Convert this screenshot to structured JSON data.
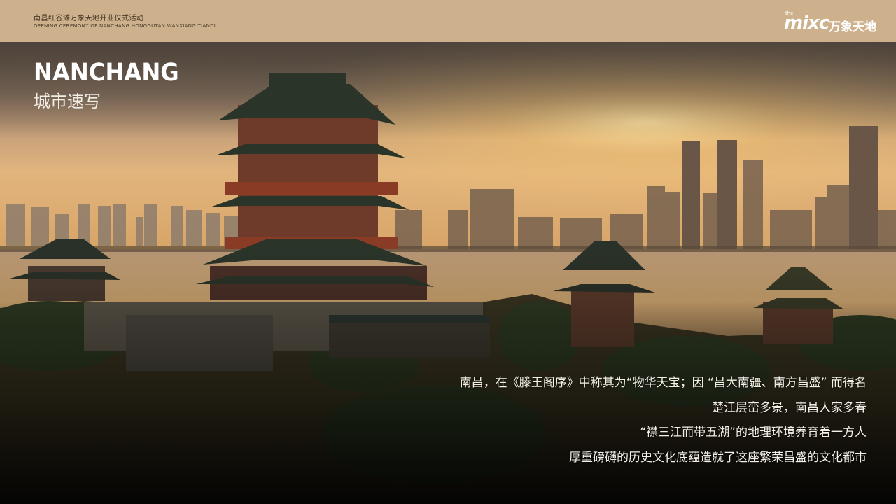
{
  "header": {
    "title_cn": "南昌红谷滩万象天地开业仪式活动",
    "title_en": "OPENING CEREMONY OF NANCHANG HONGGUTAN WANXIANG TIANDI",
    "logo": {
      "the": "the",
      "mixc": "mixc",
      "cn": "万象天地"
    }
  },
  "hero": {
    "title_en": "NANCHANG",
    "title_cn": "城市速写",
    "lines": [
      "南昌，在《滕王阁序》中称其为“物华天宝；因 “昌大南疆、南方昌盛” 而得名",
      "楚江层峦多景，南昌人家多春",
      "“襟三江而带五湖”的地理环境养育着一方人",
      "厚重磅礴的历史文化底蕴造就了这座繁荣昌盛的文化都市"
    ]
  },
  "colors": {
    "header_bg": "#cdb18c",
    "sky_top": "#6b5a48",
    "sun_glow": "#f2c170"
  }
}
